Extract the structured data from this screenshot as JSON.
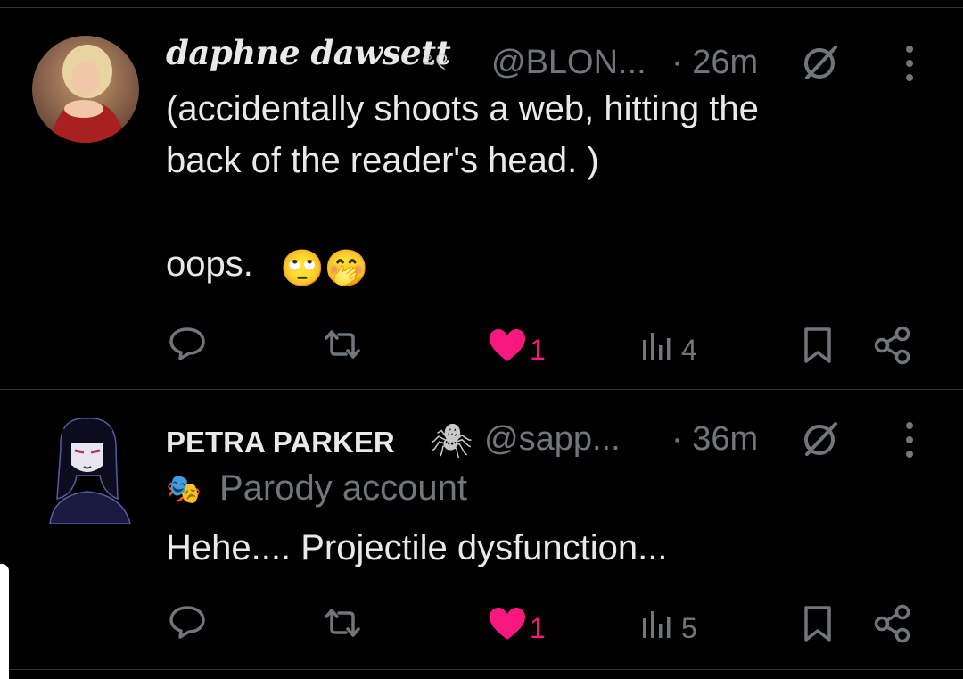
{
  "tweets": [
    {
      "display_name": "daphne dawsett",
      "name_glyphs": "⸛୧",
      "handle": "@BLON...",
      "time": "· 26m",
      "body": "(accidentally shoots a web, hitting the\nback of the reader's head. )\n\noops.",
      "emojis": "🙄🤭",
      "reply_count": "",
      "retweet_count": "",
      "like_count": "1",
      "view_count": "4"
    },
    {
      "display_name": "PETRA PARKER",
      "name_glyphs": "🕷",
      "handle": "@sapp...",
      "time": "· 36m",
      "label_icon": "🎭",
      "label": "Parody account",
      "body": "Hehe.... Projectile dysfunction...",
      "reply_count": "",
      "retweet_count": "",
      "like_count": "1",
      "view_count": "5"
    }
  ],
  "colors": {
    "background": "#000000",
    "text": "#e7e9ea",
    "muted": "#71767b",
    "like": "#f91880",
    "divider": "#2f3336"
  }
}
